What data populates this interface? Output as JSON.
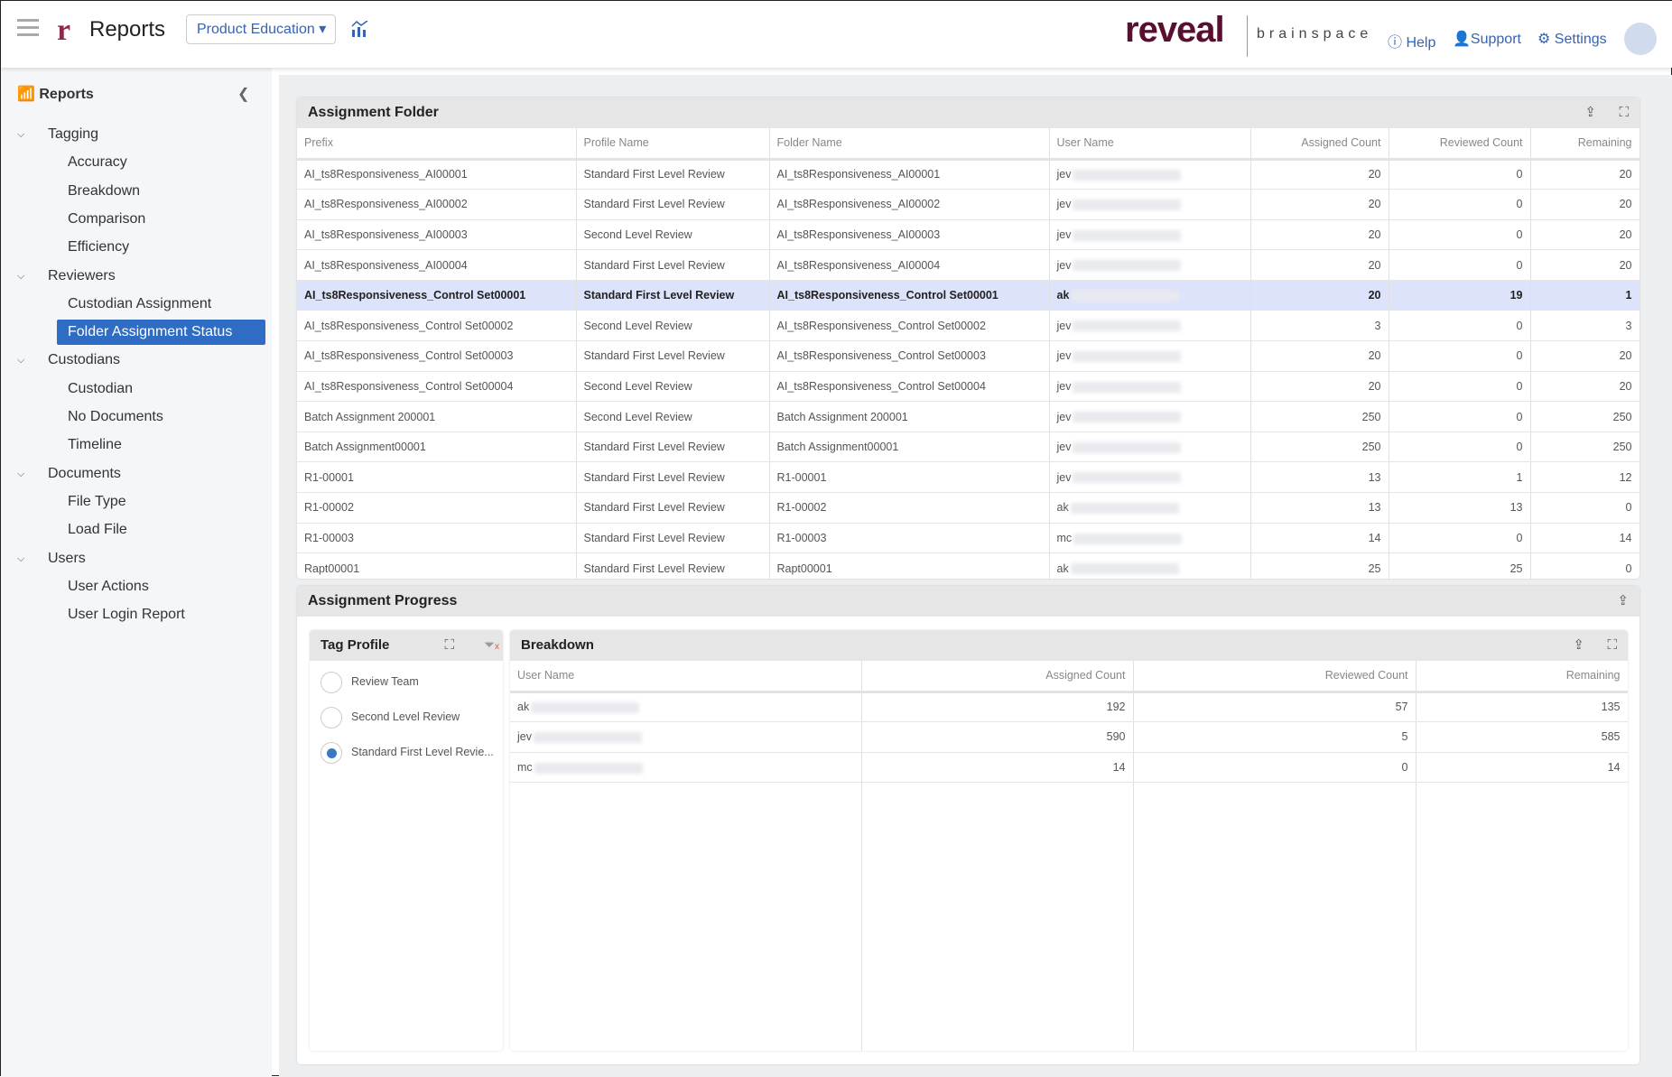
{
  "header": {
    "title": "Reports",
    "project": "Product Education",
    "brand": "reveal",
    "brand_sub": "brainspace",
    "links": [
      "Help",
      "Support",
      "Settings"
    ]
  },
  "sidebar": {
    "title": "Reports",
    "sections": [
      {
        "label": "Tagging",
        "items": [
          "Accuracy",
          "Breakdown",
          "Comparison",
          "Efficiency"
        ]
      },
      {
        "label": "Reviewers",
        "items": [
          "Custodian Assignment",
          "Folder Assignment Status"
        ]
      },
      {
        "label": "Custodians",
        "items": [
          "Custodian",
          "No Documents",
          "Timeline"
        ]
      },
      {
        "label": "Documents",
        "items": [
          "File Type",
          "Load File"
        ]
      },
      {
        "label": "Users",
        "items": [
          "User Actions",
          "User Login Report"
        ]
      }
    ],
    "selected": "Folder Assignment Status"
  },
  "assignment_folder": {
    "title": "Assignment Folder",
    "columns": [
      "Prefix",
      "Profile Name",
      "Folder Name",
      "User Name",
      "Assigned Count",
      "Reviewed Count",
      "Remaining"
    ],
    "rows": [
      [
        "AI_ts8Responsiveness_AI00001",
        "Standard First Level Review",
        "AI_ts8Responsiveness_AI00001",
        "jev",
        "20",
        "0",
        "20"
      ],
      [
        "AI_ts8Responsiveness_AI00002",
        "Standard First Level Review",
        "AI_ts8Responsiveness_AI00002",
        "jev",
        "20",
        "0",
        "20"
      ],
      [
        "AI_ts8Responsiveness_AI00003",
        "Second Level Review",
        "AI_ts8Responsiveness_AI00003",
        "jev",
        "20",
        "0",
        "20"
      ],
      [
        "AI_ts8Responsiveness_AI00004",
        "Standard First Level Review",
        "AI_ts8Responsiveness_AI00004",
        "jev",
        "20",
        "0",
        "20"
      ],
      [
        "AI_ts8Responsiveness_Control Set00001",
        "Standard First Level Review",
        "AI_ts8Responsiveness_Control Set00001",
        "ak",
        "20",
        "19",
        "1"
      ],
      [
        "AI_ts8Responsiveness_Control Set00002",
        "Second Level Review",
        "AI_ts8Responsiveness_Control Set00002",
        "jev",
        "3",
        "0",
        "3"
      ],
      [
        "AI_ts8Responsiveness_Control Set00003",
        "Standard First Level Review",
        "AI_ts8Responsiveness_Control Set00003",
        "jev",
        "20",
        "0",
        "20"
      ],
      [
        "AI_ts8Responsiveness_Control Set00004",
        "Second Level Review",
        "AI_ts8Responsiveness_Control Set00004",
        "jev",
        "20",
        "0",
        "20"
      ],
      [
        "Batch Assignment 200001",
        "Second Level Review",
        "Batch Assignment 200001",
        "jev",
        "250",
        "0",
        "250"
      ],
      [
        "Batch Assignment00001",
        "Standard First Level Review",
        "Batch Assignment00001",
        "jev",
        "250",
        "0",
        "250"
      ],
      [
        "R1-00001",
        "Standard First Level Review",
        "R1-00001",
        "jev",
        "13",
        "1",
        "12"
      ],
      [
        "R1-00002",
        "Standard First Level Review",
        "R1-00002",
        "ak",
        "13",
        "13",
        "0"
      ],
      [
        "R1-00003",
        "Standard First Level Review",
        "R1-00003",
        "mc",
        "14",
        "0",
        "14"
      ],
      [
        "Rapt00001",
        "Standard First Level Review",
        "Rapt00001",
        "ak",
        "25",
        "25",
        "0"
      ]
    ],
    "selected_row": 4
  },
  "assignment_progress": {
    "title": "Assignment Progress",
    "tag_profile": {
      "title": "Tag Profile",
      "options": [
        "Review Team",
        "Second Level Review",
        "Standard First Level Revie..."
      ],
      "selected": 2
    },
    "breakdown": {
      "title": "Breakdown",
      "columns": [
        "User Name",
        "Assigned Count",
        "Reviewed Count",
        "Remaining"
      ],
      "rows": [
        [
          "ak",
          "192",
          "57",
          "135"
        ],
        [
          "jev",
          "590",
          "5",
          "585"
        ],
        [
          "mc",
          "14",
          "0",
          "14"
        ]
      ]
    }
  }
}
